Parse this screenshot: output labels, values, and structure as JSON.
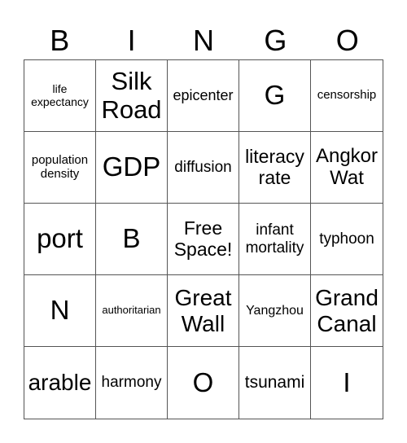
{
  "header": {
    "letters": [
      "B",
      "I",
      "N",
      "G",
      "O"
    ]
  },
  "cells": [
    "life expectancy",
    "Silk Road",
    "epicenter",
    "G",
    "censorship",
    "population density",
    "GDP",
    "diffusion",
    "literacy rate",
    "Angkor Wat",
    "port",
    "B",
    "Free Space!",
    "infant mortality",
    "typhoon",
    "N",
    "authoritarian",
    "Great Wall",
    "Yangzhou",
    "Grand Canal",
    "arable",
    "harmony",
    "O",
    "tsunami",
    "I"
  ]
}
